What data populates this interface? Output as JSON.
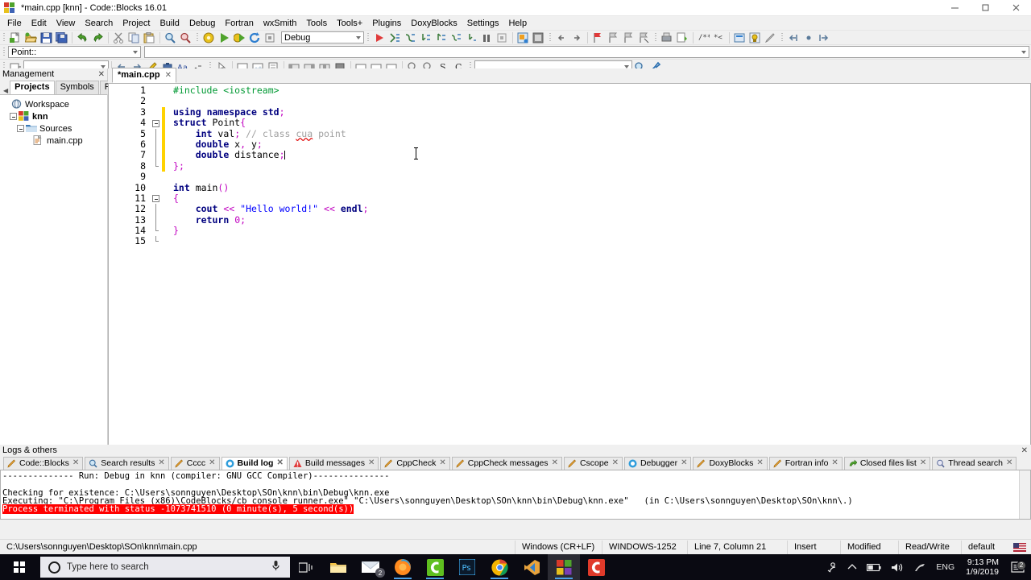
{
  "window": {
    "title": "*main.cpp [knn] - Code::Blocks 16.01",
    "icon": "codeblocks-icon",
    "controls": {
      "minimize": "minimize-icon",
      "maximize": "maximize-icon",
      "close": "close-icon"
    }
  },
  "menubar": {
    "items": [
      {
        "label": "File"
      },
      {
        "label": "Edit"
      },
      {
        "label": "View"
      },
      {
        "label": "Search"
      },
      {
        "label": "Project"
      },
      {
        "label": "Build"
      },
      {
        "label": "Debug"
      },
      {
        "label": "Fortran"
      },
      {
        "label": "wxSmith"
      },
      {
        "label": "Tools"
      },
      {
        "label": "Tools+"
      },
      {
        "label": "Plugins"
      },
      {
        "label": "DoxyBlocks"
      },
      {
        "label": "Settings"
      },
      {
        "label": "Help"
      }
    ]
  },
  "toolbar": {
    "build_target": "Debug",
    "scope_combo": "Point::",
    "function_combo": "",
    "search_combo": ""
  },
  "management": {
    "title": "Management",
    "close_label": "✕",
    "tabs": [
      {
        "label": "Projects",
        "active": true
      },
      {
        "label": "Symbols",
        "active": false
      },
      {
        "label": "Fil",
        "active": false
      }
    ],
    "tree": [
      {
        "label": "Workspace",
        "icon": "workspace-icon",
        "depth": 0,
        "bold": false,
        "expander": false
      },
      {
        "label": "knn",
        "icon": "project-icon",
        "depth": 1,
        "bold": true,
        "expander": true
      },
      {
        "label": "Sources",
        "icon": "folder-icon",
        "depth": 2,
        "bold": false,
        "expander": true
      },
      {
        "label": "main.cpp",
        "icon": "file-icon",
        "depth": 3,
        "bold": false,
        "expander": false
      }
    ]
  },
  "editor": {
    "tab": {
      "label": "*main.cpp",
      "close": "✕"
    },
    "line_numbers": [
      "1",
      "2",
      "3",
      "4",
      "5",
      "6",
      "7",
      "8",
      "9",
      "10",
      "11",
      "12",
      "13",
      "14",
      "15"
    ],
    "lines": [
      {
        "n": 1,
        "modified": false,
        "tokens": [
          {
            "t": "#include <iostream>",
            "c": "k-pre"
          }
        ]
      },
      {
        "n": 2,
        "modified": false,
        "tokens": []
      },
      {
        "n": 3,
        "modified": true,
        "tokens": [
          {
            "t": "using",
            "c": "k-kw"
          },
          {
            "t": " ",
            "c": "k-id"
          },
          {
            "t": "namespace",
            "c": "k-kw"
          },
          {
            "t": " ",
            "c": "k-id"
          },
          {
            "t": "std",
            "c": "k-kw"
          },
          {
            "t": ";",
            "c": "k-op"
          }
        ]
      },
      {
        "n": 4,
        "modified": true,
        "tokens": [
          {
            "t": "struct",
            "c": "k-kw"
          },
          {
            "t": " Point",
            "c": "k-id"
          },
          {
            "t": "{",
            "c": "k-op"
          }
        ]
      },
      {
        "n": 5,
        "modified": true,
        "tokens": [
          {
            "t": "    ",
            "c": "k-id"
          },
          {
            "t": "int",
            "c": "k-kw"
          },
          {
            "t": " val",
            "c": "k-id"
          },
          {
            "t": ";",
            "c": "k-op"
          },
          {
            "t": " ",
            "c": "k-id"
          },
          {
            "t": "// class ",
            "c": "k-com"
          },
          {
            "t": "cua",
            "c": "k-com-err"
          },
          {
            "t": " point",
            "c": "k-com"
          }
        ]
      },
      {
        "n": 6,
        "modified": true,
        "tokens": [
          {
            "t": "    ",
            "c": "k-id"
          },
          {
            "t": "double",
            "c": "k-kw"
          },
          {
            "t": " x",
            "c": "k-id"
          },
          {
            "t": ",",
            "c": "k-op"
          },
          {
            "t": " y",
            "c": "k-id"
          },
          {
            "t": ";",
            "c": "k-op"
          }
        ]
      },
      {
        "n": 7,
        "modified": true,
        "tokens": [
          {
            "t": "    ",
            "c": "k-id"
          },
          {
            "t": "double",
            "c": "k-kw"
          },
          {
            "t": " distance",
            "c": "k-id"
          },
          {
            "t": ";",
            "c": "k-op"
          }
        ],
        "caret": true
      },
      {
        "n": 8,
        "modified": true,
        "tokens": [
          {
            "t": "}",
            "c": "k-op"
          },
          {
            "t": ";",
            "c": "k-op"
          }
        ]
      },
      {
        "n": 9,
        "modified": false,
        "tokens": []
      },
      {
        "n": 10,
        "modified": false,
        "tokens": [
          {
            "t": "int",
            "c": "k-kw"
          },
          {
            "t": " main",
            "c": "k-id"
          },
          {
            "t": "()",
            "c": "k-op"
          }
        ]
      },
      {
        "n": 11,
        "modified": false,
        "tokens": [
          {
            "t": "{",
            "c": "k-op"
          }
        ]
      },
      {
        "n": 12,
        "modified": false,
        "tokens": [
          {
            "t": "    ",
            "c": "k-id"
          },
          {
            "t": "cout",
            "c": "k-kw"
          },
          {
            "t": " ",
            "c": "k-id"
          },
          {
            "t": "<<",
            "c": "k-op"
          },
          {
            "t": " ",
            "c": "k-id"
          },
          {
            "t": "\"Hello world!\"",
            "c": "k-str"
          },
          {
            "t": " ",
            "c": "k-id"
          },
          {
            "t": "<<",
            "c": "k-op"
          },
          {
            "t": " ",
            "c": "k-id"
          },
          {
            "t": "endl",
            "c": "k-kw"
          },
          {
            "t": ";",
            "c": "k-op"
          }
        ]
      },
      {
        "n": 13,
        "modified": false,
        "tokens": [
          {
            "t": "    ",
            "c": "k-id"
          },
          {
            "t": "return",
            "c": "k-kw"
          },
          {
            "t": " ",
            "c": "k-id"
          },
          {
            "t": "0",
            "c": "k-num"
          },
          {
            "t": ";",
            "c": "k-op"
          }
        ]
      },
      {
        "n": 14,
        "modified": false,
        "tokens": [
          {
            "t": "}",
            "c": "k-op"
          }
        ]
      },
      {
        "n": 15,
        "modified": false,
        "tokens": []
      }
    ]
  },
  "logs": {
    "title": "Logs & others",
    "close_label": "✕",
    "tabs": [
      {
        "label": "Code::Blocks",
        "icon": "pencil-icon",
        "active": false
      },
      {
        "label": "Search results",
        "icon": "search-icon",
        "active": false
      },
      {
        "label": "Cccc",
        "icon": "pencil-icon",
        "active": false
      },
      {
        "label": "Build log",
        "icon": "build-icon",
        "active": true
      },
      {
        "label": "Build messages",
        "icon": "warning-icon",
        "active": false
      },
      {
        "label": "CppCheck",
        "icon": "pencil-icon",
        "active": false
      },
      {
        "label": "CppCheck messages",
        "icon": "pencil-icon",
        "active": false
      },
      {
        "label": "Cscope",
        "icon": "pencil-icon",
        "active": false
      },
      {
        "label": "Debugger",
        "icon": "debug-icon",
        "active": false
      },
      {
        "label": "DoxyBlocks",
        "icon": "pencil-icon",
        "active": false
      },
      {
        "label": "Fortran info",
        "icon": "pencil-icon",
        "active": false
      },
      {
        "label": "Closed files list",
        "icon": "closed-files-icon",
        "active": false
      },
      {
        "label": "Thread search",
        "icon": "thread-search-icon",
        "active": false
      }
    ],
    "build_log": [
      {
        "text": "-------------- Run: Debug in knn (compiler: GNU GCC Compiler)---------------",
        "error": false
      },
      {
        "text": "",
        "error": false
      },
      {
        "text": "Checking for existence: C:\\Users\\sonnguyen\\Desktop\\SOn\\knn\\bin\\Debug\\knn.exe",
        "error": false
      },
      {
        "text": "Executing: \"C:\\Program Files (x86)\\CodeBlocks/cb_console_runner.exe\" \"C:\\Users\\sonnguyen\\Desktop\\SOn\\knn\\bin\\Debug\\knn.exe\"   (in C:\\Users\\sonnguyen\\Desktop\\SOn\\knn\\.)",
        "error": false
      },
      {
        "text": "Process terminated with status -1073741510 (0 minute(s), 5 second(s))",
        "error": true
      }
    ]
  },
  "statusbar": {
    "path": "C:\\Users\\sonnguyen\\Desktop\\SOn\\knn\\main.cpp",
    "eol": "Windows (CR+LF)",
    "encoding": "WINDOWS-1252",
    "cursor": "Line 7, Column 21",
    "insert_mode": "Insert",
    "modified": "Modified",
    "permission": "Read/Write",
    "profile": "default",
    "flag": "us-flag-icon"
  },
  "taskbar": {
    "start": "windows-start-icon",
    "search_placeholder": "Type here to search",
    "mic": "microphone-icon",
    "items": [
      {
        "name": "task-view-icon",
        "active": false,
        "running": false
      },
      {
        "name": "file-explorer-icon",
        "active": false,
        "running": false
      },
      {
        "name": "mail-icon",
        "active": false,
        "running": false,
        "badge": "2"
      },
      {
        "name": "firefox-icon",
        "active": false,
        "running": true
      },
      {
        "name": "camtasia-icon",
        "active": false,
        "running": true
      },
      {
        "name": "photoshop-icon",
        "active": false,
        "running": false
      },
      {
        "name": "chrome-icon",
        "active": false,
        "running": true
      },
      {
        "name": "visual-studio-icon",
        "active": false,
        "running": false
      },
      {
        "name": "codeblocks-icon",
        "active": true,
        "running": true
      },
      {
        "name": "camtasia-recorder-icon",
        "active": false,
        "running": false
      }
    ],
    "tray": {
      "pen": "pen-icon",
      "chevron": "show-hidden-icons-icon",
      "battery": "battery-icon",
      "volume": "volume-icon",
      "network": "wifi-icon",
      "language": "ENG",
      "time": "9:13 PM",
      "date": "1/9/2019",
      "notifications_badge": "2"
    }
  },
  "colors": {
    "accent": "#0078d7",
    "error_bg": "#ff0000",
    "keyword": "#00007f",
    "string": "#0000ff",
    "comment": "#a0a0a0",
    "preproc": "#009933",
    "operator": "#c000c0",
    "modified_bar": "#ffd200"
  }
}
